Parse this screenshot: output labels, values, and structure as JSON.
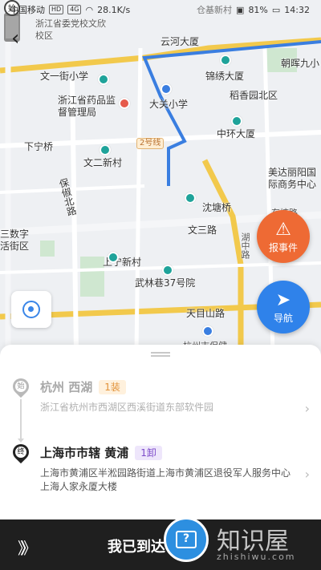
{
  "status_bar": {
    "carrier": "中国移动",
    "net_badge_1": "HD",
    "net_badge_2": "4G",
    "speed": "28.1K/s",
    "center_text": "仓基新村",
    "battery": "81%",
    "time": "14:32"
  },
  "map": {
    "labels": {
      "zhejiang_party_school": "浙江省委党校文欣校区",
      "yunhe_tower": "云河大厦",
      "chaohui_9": "朝晖九小",
      "wenyi_school": "文一街小学",
      "jinxiu_tower": "锦绣大厦",
      "drug_admin": "浙江省药品监督管理局",
      "daguan_school": "大关小学",
      "daoxiang_north": "稻香园北区",
      "xianning_bridge": "下宁桥",
      "zhonghuan_tower": "中环大厦",
      "wener_village": "文二新村",
      "meida_center": "美达丽阳国际商务中心",
      "baochu_north": "保俶北路",
      "yuantang_bridge": "沈塘桥",
      "digital_block": "三数字活街区",
      "wensan_road": "文三路",
      "shangning_village": "上宁新村",
      "wulin_lane": "武林巷37号院",
      "tianmu_road": "天目山路",
      "hangzhou_hotel": "杭州市保健",
      "road_2_badge": "2号线",
      "dongtang_road": "东塘路",
      "hainan_road": "湖中路"
    }
  },
  "buttons": {
    "report": "报事件",
    "navigate": "导航"
  },
  "stops": {
    "origin": {
      "pin_glyph": "始",
      "title": "杭州 西湖",
      "tag": "1装",
      "address": "浙江省杭州市西湖区西溪街道东部软件园"
    },
    "destination": {
      "pin_glyph": "终",
      "title": "上海市市辖 黄浦",
      "tag": "1卸",
      "address": "上海市黄浦区半淞园路街道上海市黄浦区退役军人服务中心上海人家永厦大楼"
    }
  },
  "action_bar": {
    "arrive_label": "我已到达",
    "slide_glyph": "》》"
  },
  "watermark": {
    "text": "知识屋",
    "url": "zhishiwu.com"
  },
  "colors": {
    "route": "#3a7ee0",
    "report": "#ee6a34",
    "navigate": "#2f82ea",
    "unload_tag": "#7c4ac9",
    "load_tag": "#e2923a"
  }
}
